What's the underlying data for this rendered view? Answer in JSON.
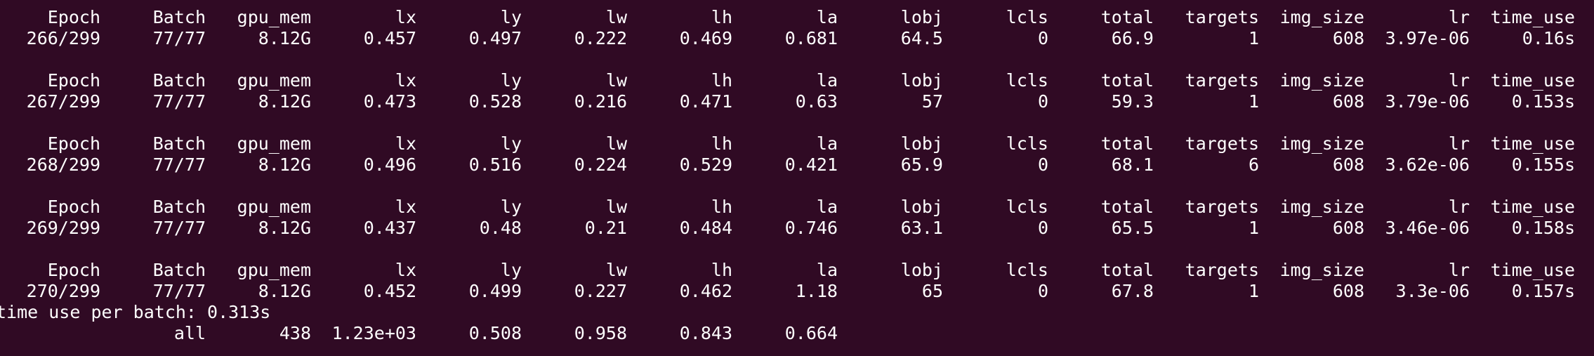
{
  "headers": [
    "Epoch",
    "Batch",
    "gpu_mem",
    "lx",
    "ly",
    "lw",
    "lh",
    "la",
    "lobj",
    "lcls",
    "total",
    "targets",
    "img_size",
    "lr",
    "time_use"
  ],
  "rows": [
    [
      "266/299",
      "77/77",
      "8.12G",
      "0.457",
      "0.497",
      "0.222",
      "0.469",
      "0.681",
      "64.5",
      "0",
      "66.9",
      "1",
      "608",
      "3.97e-06",
      "0.16s"
    ],
    [
      "267/299",
      "77/77",
      "8.12G",
      "0.473",
      "0.528",
      "0.216",
      "0.471",
      "0.63",
      "57",
      "0",
      "59.3",
      "1",
      "608",
      "3.79e-06",
      "0.153s"
    ],
    [
      "268/299",
      "77/77",
      "8.12G",
      "0.496",
      "0.516",
      "0.224",
      "0.529",
      "0.421",
      "65.9",
      "0",
      "68.1",
      "6",
      "608",
      "3.62e-06",
      "0.155s"
    ],
    [
      "269/299",
      "77/77",
      "8.12G",
      "0.437",
      "0.48",
      "0.21",
      "0.484",
      "0.746",
      "63.1",
      "0",
      "65.5",
      "1",
      "608",
      "3.46e-06",
      "0.158s"
    ],
    [
      "270/299",
      "77/77",
      "8.12G",
      "0.452",
      "0.499",
      "0.227",
      "0.462",
      "1.18",
      "65",
      "0",
      "67.8",
      "1",
      "608",
      "3.3e-06",
      "0.157s"
    ]
  ],
  "summary_line": "time use per batch: 0.313s",
  "eval_row": [
    "all",
    "438",
    "1.23e+03",
    "0.508",
    "0.958",
    "0.843",
    "0.664"
  ]
}
